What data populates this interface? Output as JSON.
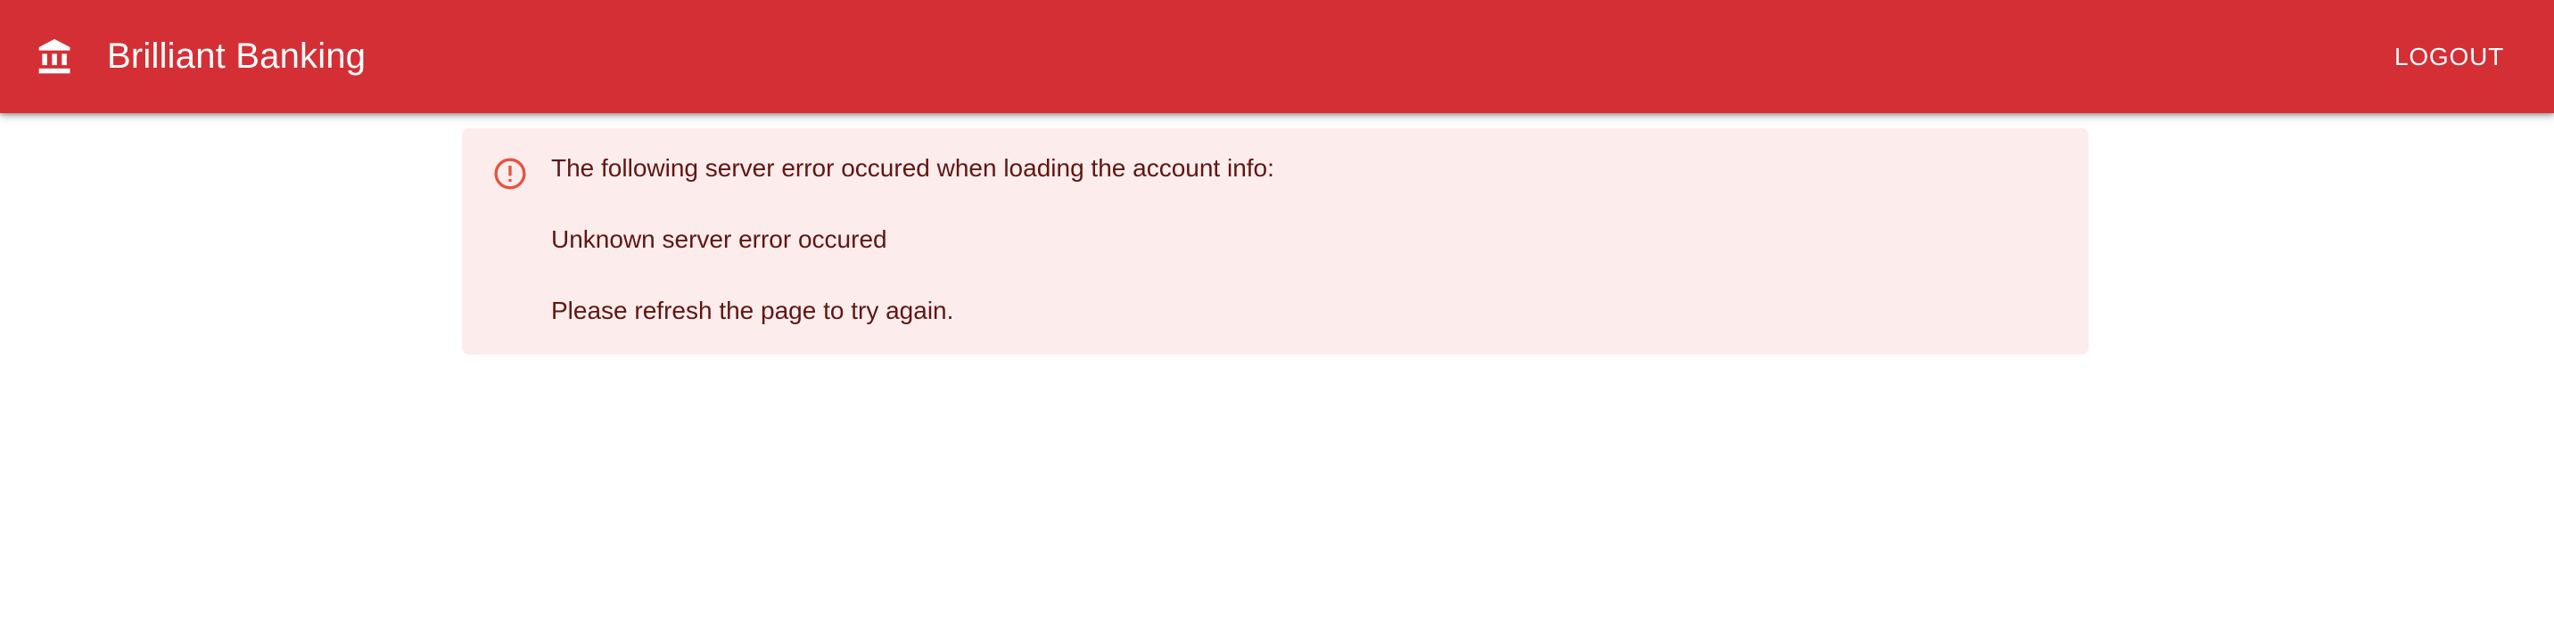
{
  "header": {
    "icon": "bank-icon",
    "title": "Brilliant Banking",
    "logout_label": "LOGOUT",
    "background_color": "#d32f35"
  },
  "alert": {
    "severity": "error",
    "icon": "error-outline-icon",
    "background_color": "#fdecec",
    "icon_color": "#e5533f",
    "text_color": "#5f1612",
    "lines": [
      "The following server error occured when loading the account info:",
      "Unknown server error occured",
      "Please refresh the page to try again."
    ]
  }
}
